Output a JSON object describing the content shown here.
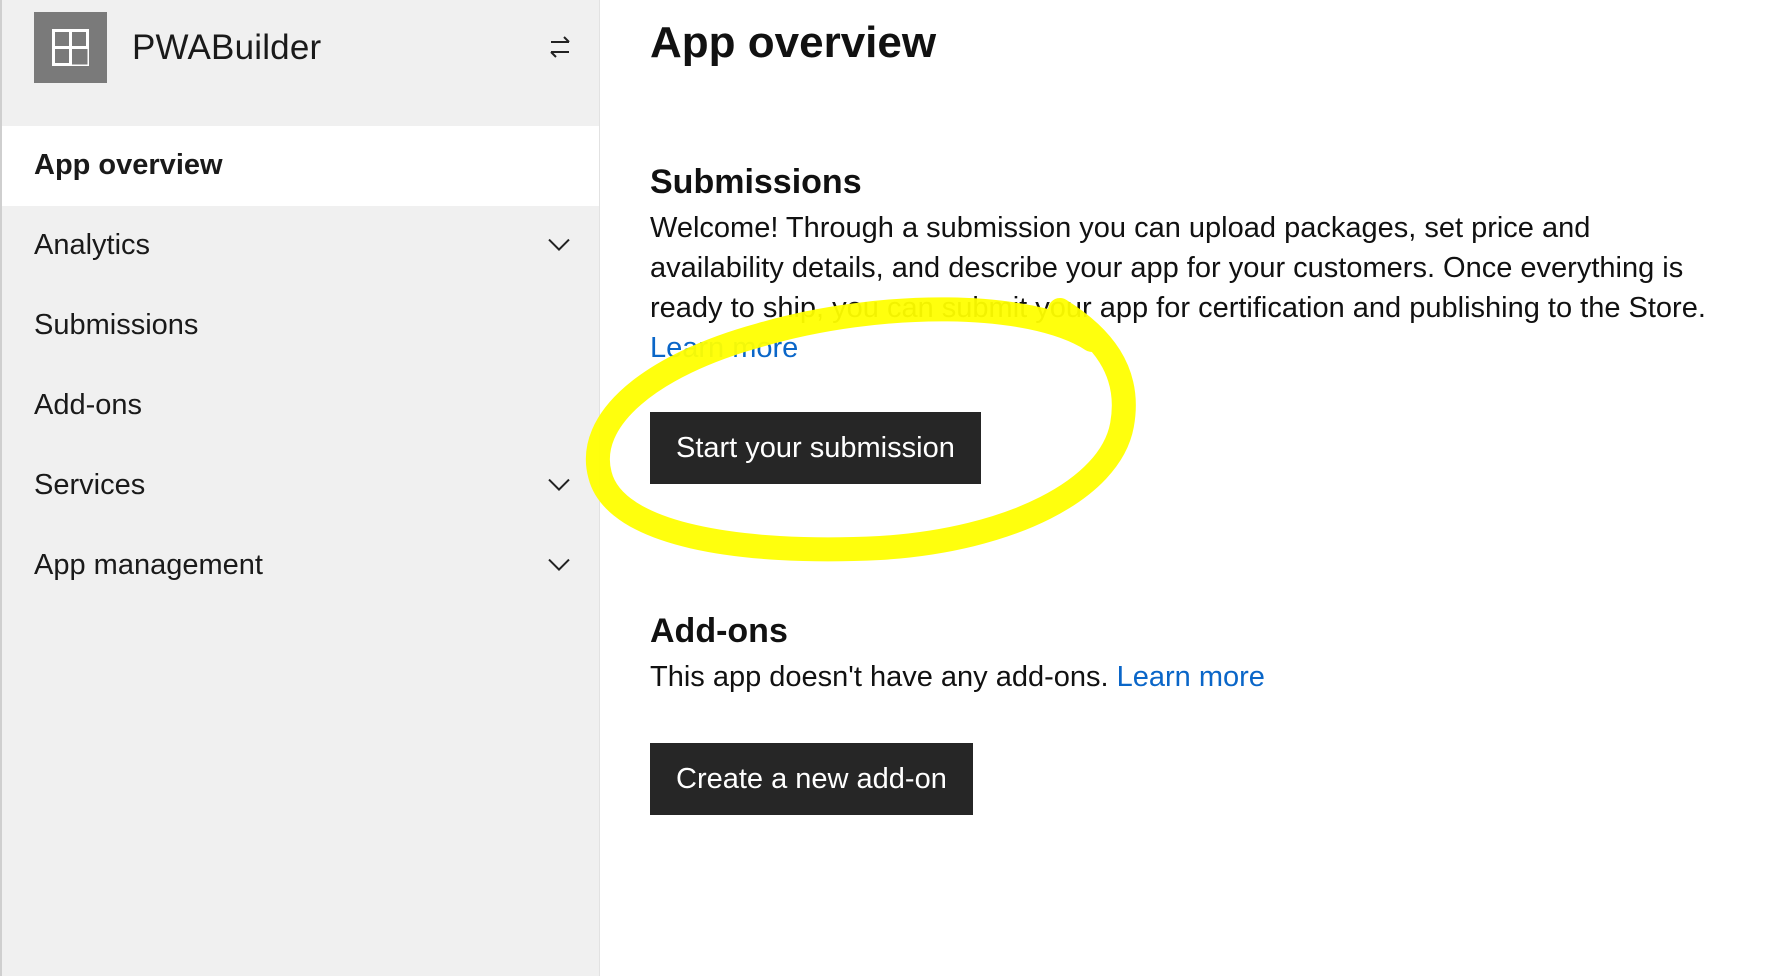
{
  "sidebar": {
    "app_name": "PWABuilder",
    "app_icon": "app-tile-icon",
    "switch_icon": "switch-arrows-icon",
    "items": [
      {
        "label": "App overview",
        "active": true,
        "expandable": false
      },
      {
        "label": "Analytics",
        "active": false,
        "expandable": true
      },
      {
        "label": "Submissions",
        "active": false,
        "expandable": false
      },
      {
        "label": "Add-ons",
        "active": false,
        "expandable": false
      },
      {
        "label": "Services",
        "active": false,
        "expandable": true
      },
      {
        "label": "App management",
        "active": false,
        "expandable": true
      }
    ]
  },
  "main": {
    "title": "App overview",
    "submissions": {
      "heading": "Submissions",
      "text": "Welcome! Through a submission you can upload packages, set price and availability details, and describe your app for your customers. Once everything is ready to ship, you can submit your app for certification and publishing to the Store.",
      "link": "Learn more",
      "button": "Start your submission"
    },
    "addons": {
      "heading": "Add-ons",
      "text": "This app doesn't have any add-ons.",
      "link": "Learn more",
      "button": "Create a new add-on"
    }
  },
  "colors": {
    "sidebar_bg": "#f0f0f0",
    "button_bg": "#262626",
    "link": "#0a66c8",
    "highlight": "#ffff00"
  }
}
